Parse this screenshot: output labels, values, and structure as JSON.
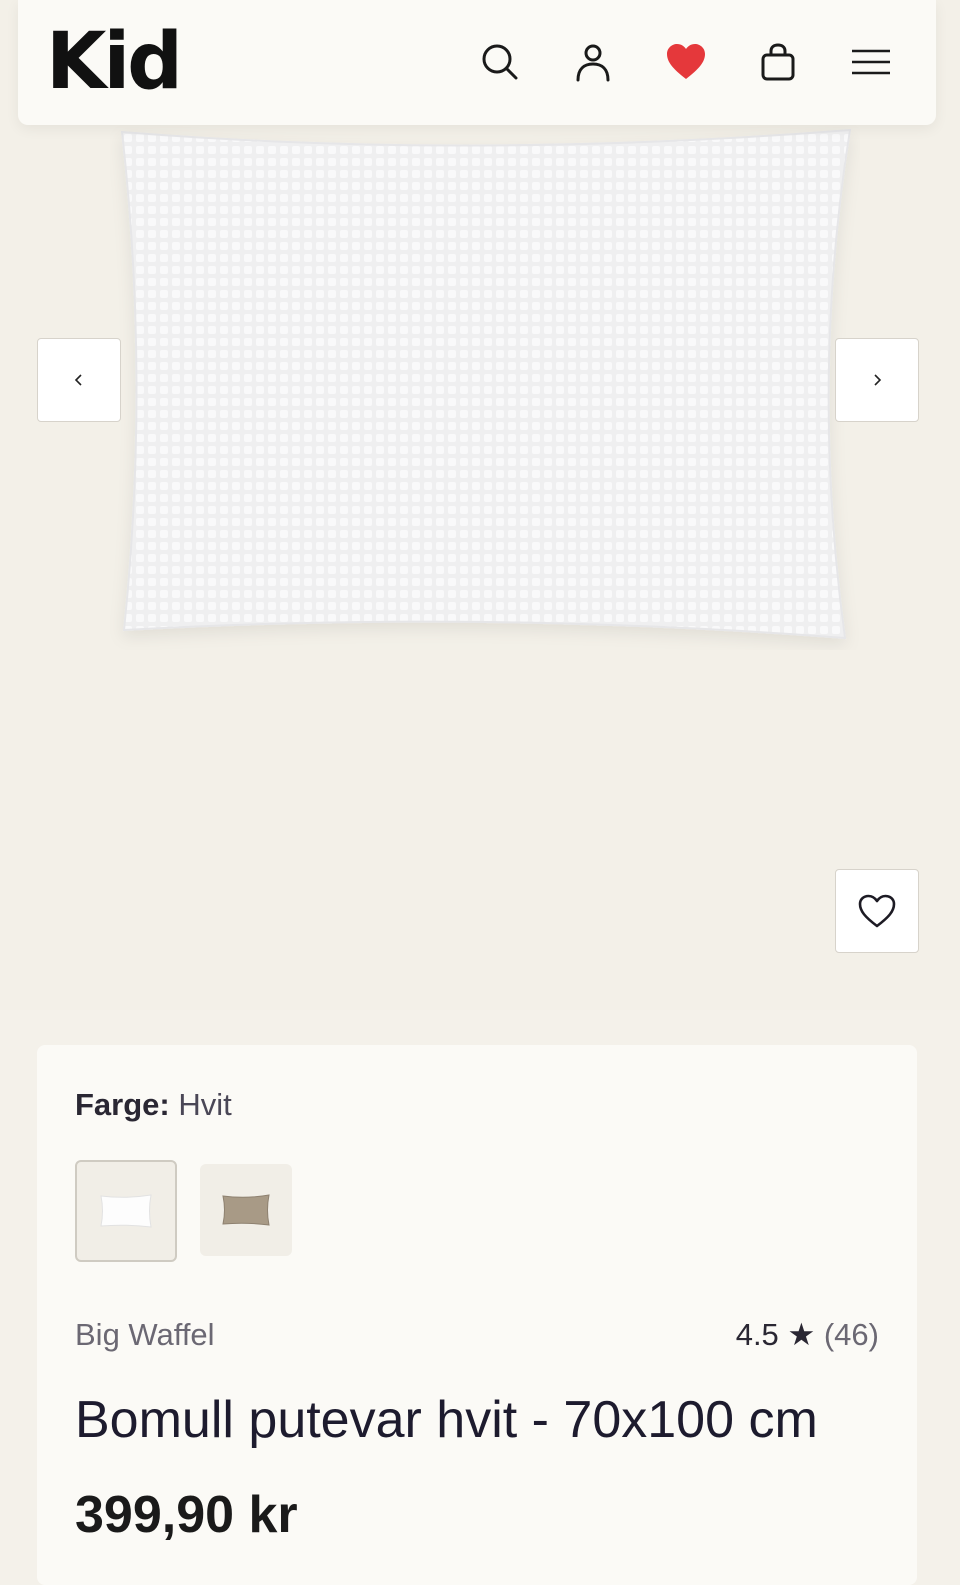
{
  "header": {
    "logo": "Kid",
    "icons": [
      "search-icon",
      "user-icon",
      "heart-filled-icon",
      "shopping-bag-icon",
      "menu-icon"
    ],
    "favorite_color": "#e5383b"
  },
  "gallery": {
    "prev_icon": "chevron-left-icon",
    "next_icon": "chevron-right-icon",
    "wishlist_icon": "heart-outline-icon"
  },
  "product": {
    "color_label": "Farge:",
    "color_value": "Hvit",
    "swatches": [
      {
        "name": "white-swatch",
        "selected": true
      },
      {
        "name": "beige-swatch",
        "selected": false
      }
    ],
    "brand": "Big Waffel",
    "rating": "4.5",
    "rating_star": "★",
    "review_count": "(46)",
    "title": "Bomull putevar hvit - 70x100 cm",
    "price": "399,90 kr"
  }
}
